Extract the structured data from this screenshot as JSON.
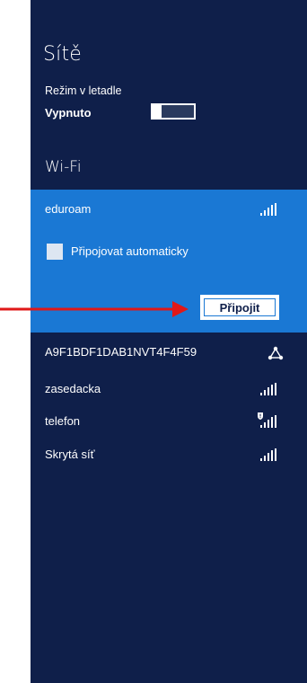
{
  "panel": {
    "title": "Sítě",
    "airplane_mode": {
      "label": "Režim v letadle",
      "state": "Vypnuto"
    },
    "wifi_header": "Wi-Fi",
    "selected_network": {
      "name": "eduroam",
      "signal_icon": "wifi-signal-icon",
      "auto_connect_label": "Připojovat automaticky",
      "auto_connect_checked": false,
      "connect_label": "Připojit"
    },
    "networks": [
      {
        "name": "A9F1BDF1DAB1NVT4F4F59",
        "icon": "adhoc-network-icon"
      },
      {
        "name": "zasedacka",
        "icon": "wifi-signal-icon"
      },
      {
        "name": "telefon",
        "icon": "wifi-secured-warning-icon"
      },
      {
        "name": "Skrytá síť",
        "icon": "wifi-signal-icon"
      }
    ]
  },
  "colors": {
    "panel_bg": "#0f1f4a",
    "selected_bg": "#1a78d4",
    "arrow": "#e01818"
  }
}
